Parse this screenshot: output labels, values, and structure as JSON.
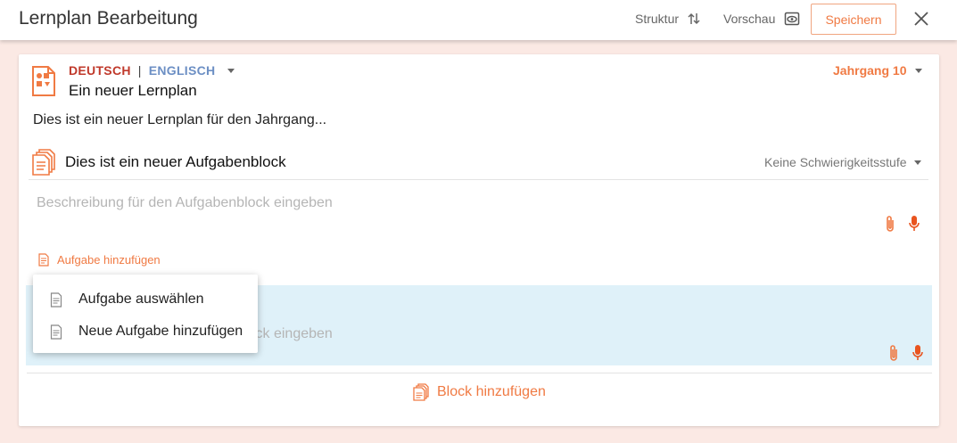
{
  "header": {
    "title": "Lernplan Bearbeitung",
    "struktur_label": "Struktur",
    "vorschau_label": "Vorschau",
    "save_label": "Speichern"
  },
  "plan": {
    "lang_primary": "DEUTSCH",
    "lang_separator": "|",
    "lang_secondary": "ENGLISCH",
    "title": "Ein neuer Lernplan",
    "grade": "Jahrgang 10",
    "description": "Dies ist ein neuer Lernplan für den Jahrgang..."
  },
  "block": {
    "title": "Dies ist ein neuer Aufgabenblock",
    "difficulty": "Keine Schwierigkeitsstufe",
    "description_placeholder": "Beschreibung für den Aufgabenblock eingeben",
    "add_task_label": "Aufgabe hinzufügen"
  },
  "task_row": {
    "placeholder": "Beschreibung für den Aufgabenblock eingeben"
  },
  "add_block_label": "Block hinzufügen",
  "dropdown": {
    "items": [
      {
        "label": "Aufgabe auswählen"
      },
      {
        "label": "Neue Aufgabe hinzufügen"
      }
    ]
  },
  "colors": {
    "accent": "#f07a43",
    "lang_primary": "#c0392b",
    "lang_secondary": "#6c8fc4",
    "task_row_bg": "#dff1f9",
    "page_bg": "#fbe9e4"
  },
  "icons": [
    "swap-vertical-icon",
    "eye-icon",
    "close-icon",
    "lernplan-doc-icon",
    "block-stack-icon",
    "paperclip-icon",
    "microphone-icon",
    "task-doc-icon"
  ]
}
